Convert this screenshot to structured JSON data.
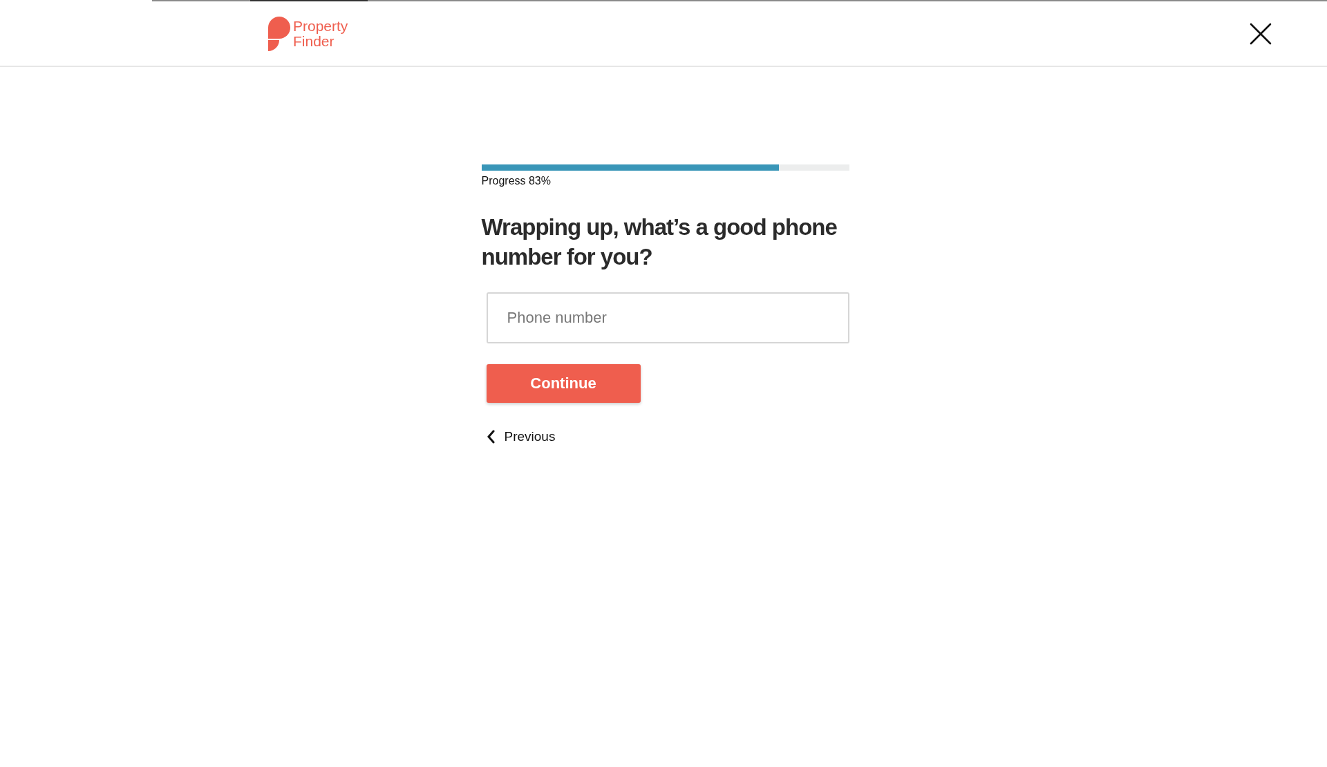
{
  "header": {
    "logo_text": [
      "Property",
      "Finder"
    ]
  },
  "progress": {
    "level": 0.81,
    "label": "Progress 83%"
  },
  "question": "Wrapping up,  what’s a good phone number for you?",
  "phone_field": {
    "placeholder": "Phone number"
  },
  "continue_button": "Continue",
  "previous_link": "Previous"
}
